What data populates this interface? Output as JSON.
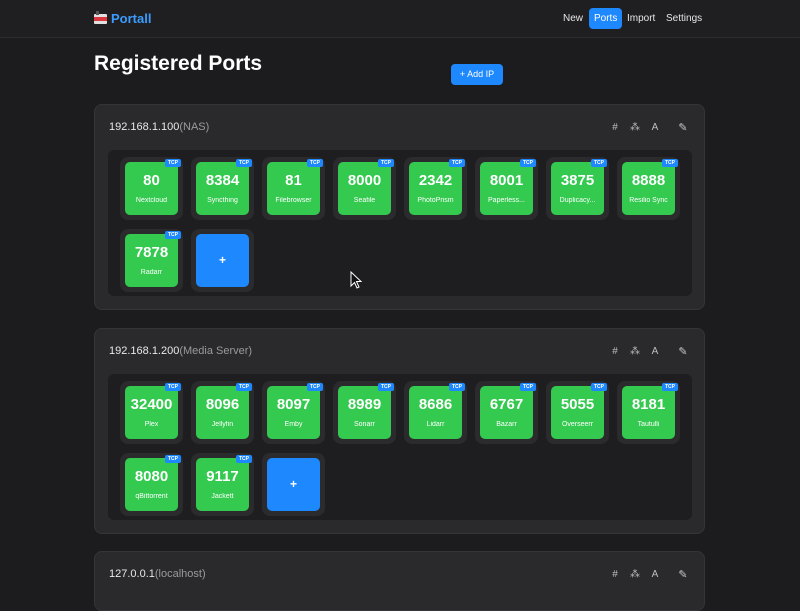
{
  "nav": {
    "brand": "Portall",
    "items": [
      {
        "label": "New",
        "active": false
      },
      {
        "label": "Ports",
        "active": true
      },
      {
        "label": "Import",
        "active": false
      },
      {
        "label": "Settings",
        "active": false
      }
    ]
  },
  "page_title": "Registered Ports",
  "add_ip_label": "+ Add IP",
  "icons": {
    "hash": "#",
    "sitemap": "⁂",
    "font": "A",
    "pencil": "✎"
  },
  "colors": {
    "port_green": "#34c94f",
    "accent_blue": "#1e88ff"
  },
  "groups": [
    {
      "ip": "192.168.1.100",
      "desc": "(NAS)",
      "ports": [
        {
          "port": "80",
          "name": "Nextcloud",
          "proto": "TCP"
        },
        {
          "port": "8384",
          "name": "Syncthing",
          "proto": "TCP"
        },
        {
          "port": "81",
          "name": "Filebrowser",
          "proto": "TCP"
        },
        {
          "port": "8000",
          "name": "Seafile",
          "proto": "TCP"
        },
        {
          "port": "2342",
          "name": "PhotoPrism",
          "proto": "TCP"
        },
        {
          "port": "8001",
          "name": "Paperless...",
          "proto": "TCP"
        },
        {
          "port": "3875",
          "name": "Duplicacy...",
          "proto": "TCP"
        },
        {
          "port": "8888",
          "name": "Resilio Sync",
          "proto": "TCP"
        },
        {
          "port": "7878",
          "name": "Radarr",
          "proto": "TCP"
        }
      ]
    },
    {
      "ip": "192.168.1.200",
      "desc": "(Media Server)",
      "ports": [
        {
          "port": "32400",
          "name": "Plex",
          "proto": "TCP"
        },
        {
          "port": "8096",
          "name": "Jellyfin",
          "proto": "TCP"
        },
        {
          "port": "8097",
          "name": "Emby",
          "proto": "TCP"
        },
        {
          "port": "8989",
          "name": "Sonarr",
          "proto": "TCP"
        },
        {
          "port": "8686",
          "name": "Lidarr",
          "proto": "TCP"
        },
        {
          "port": "6767",
          "name": "Bazarr",
          "proto": "TCP"
        },
        {
          "port": "5055",
          "name": "Overseerr",
          "proto": "TCP"
        },
        {
          "port": "8181",
          "name": "Tautulli",
          "proto": "TCP"
        },
        {
          "port": "8080",
          "name": "qBittorrent",
          "proto": "TCP"
        },
        {
          "port": "9117",
          "name": "Jackett",
          "proto": "TCP"
        }
      ]
    },
    {
      "ip": "127.0.0.1",
      "desc": "(localhost)",
      "ports": []
    }
  ],
  "add_port_label": "+"
}
